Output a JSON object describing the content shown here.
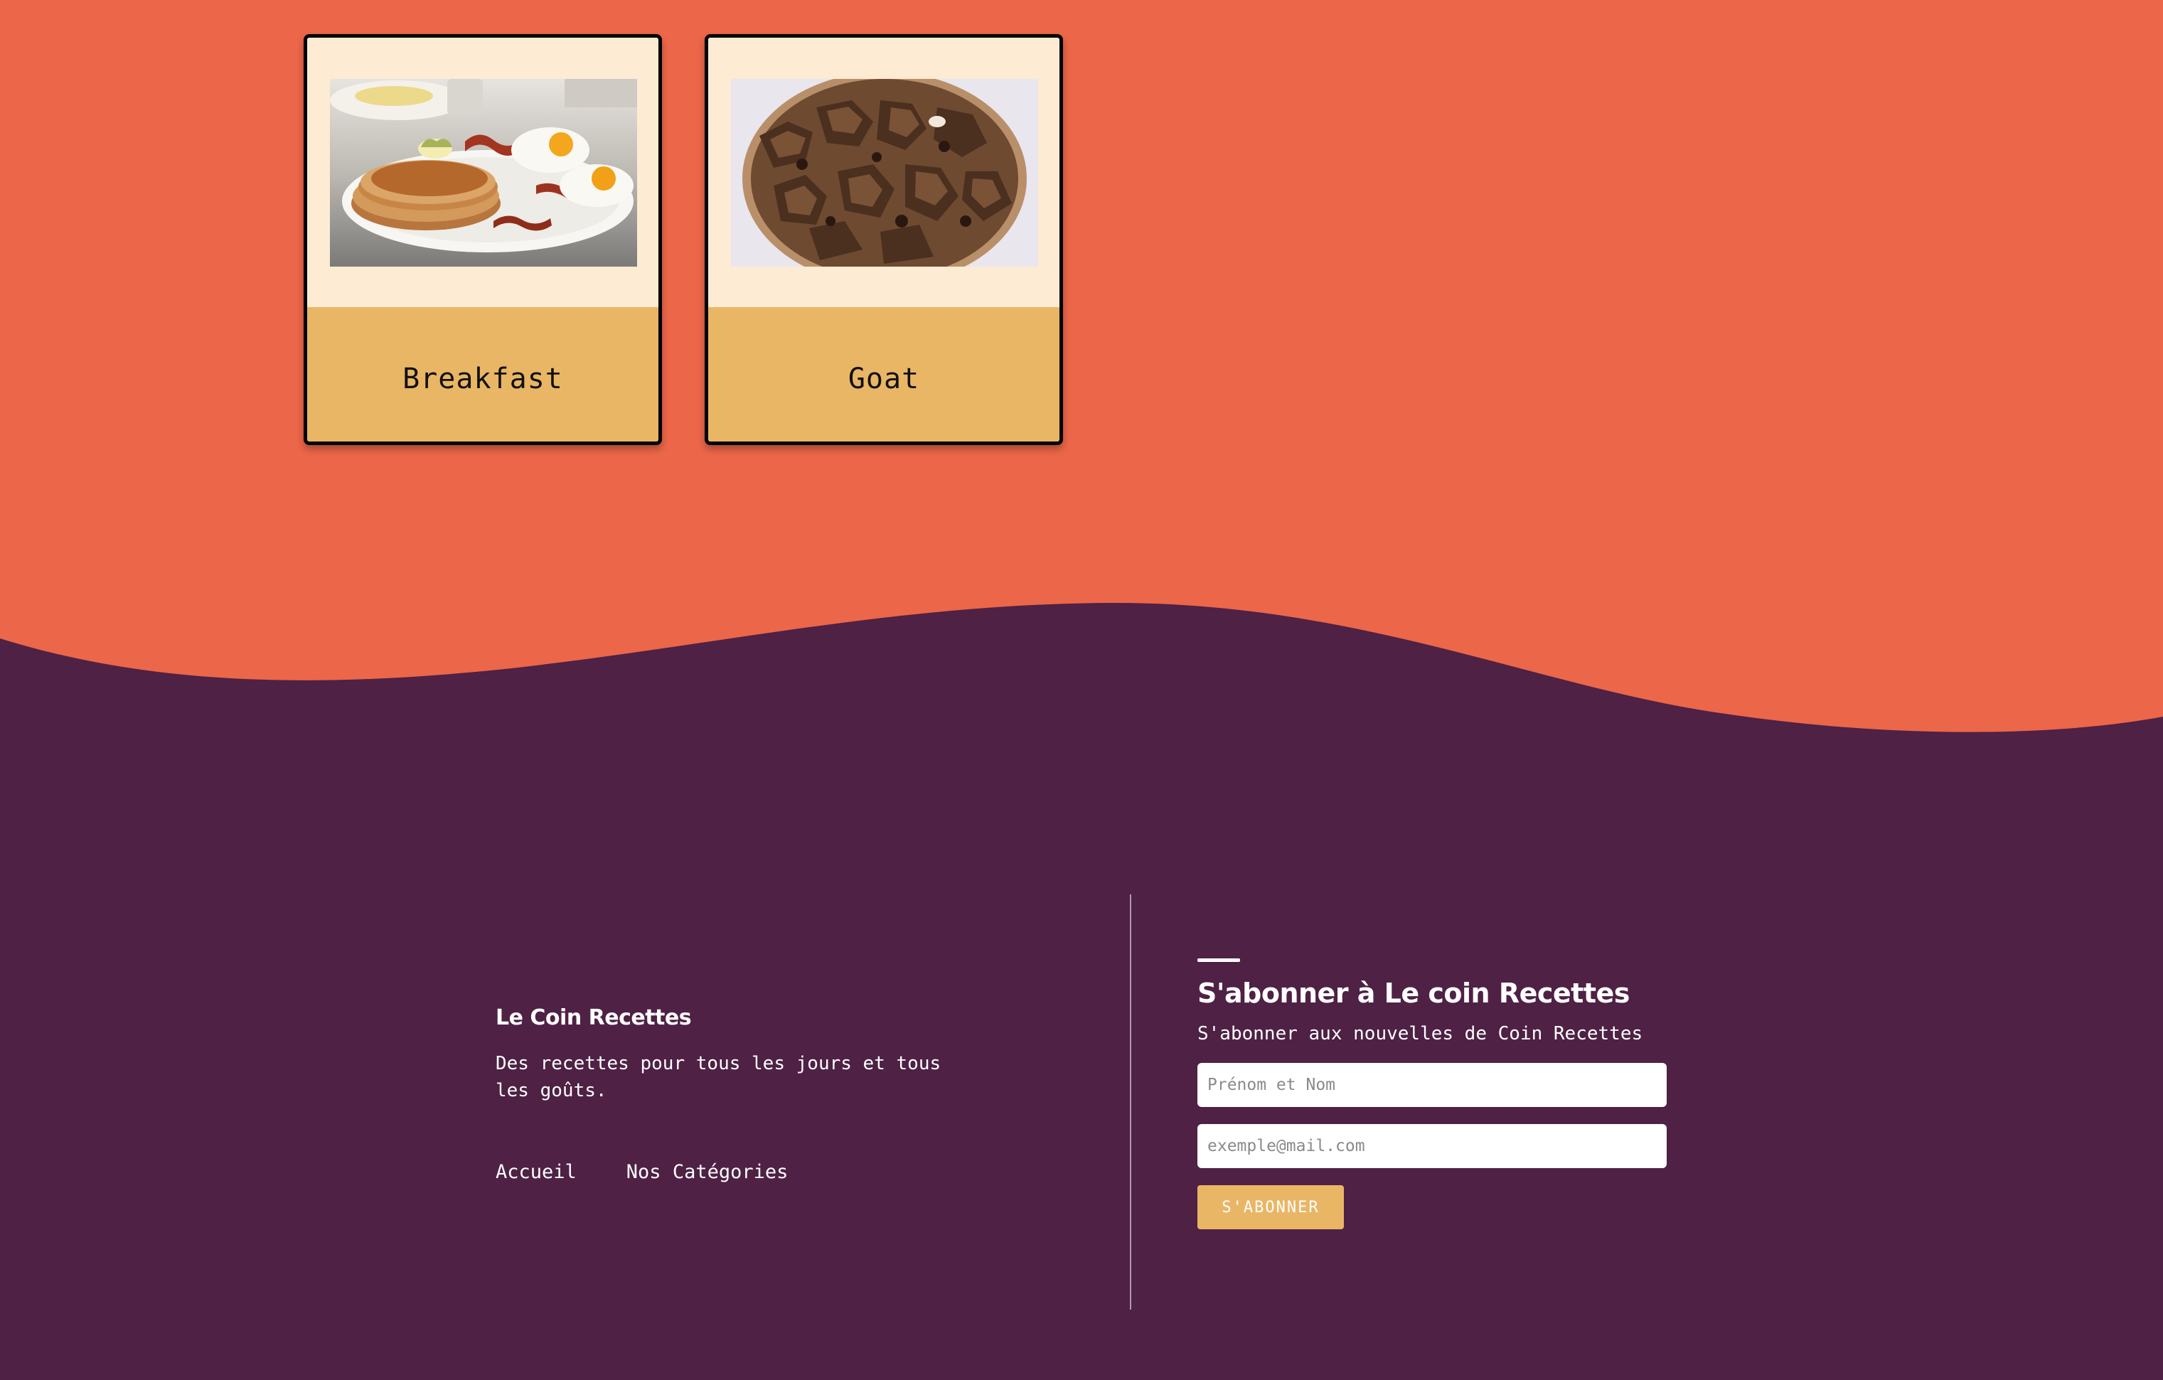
{
  "colors": {
    "top_background": "#ec6649",
    "footer_background": "#4e2145",
    "card_top": "#fdebd3",
    "card_bottom": "#e9b665",
    "button": "#e9b665"
  },
  "categories": [
    {
      "title": "Breakfast",
      "image": "pancakes-eggs-bacon-photo"
    },
    {
      "title": "Goat",
      "image": "grilled-goat-meat-bowl-photo"
    }
  ],
  "footer": {
    "brand": "Le Coin Recettes",
    "tagline": "Des recettes pour tous les jours et tous les goûts.",
    "links": [
      "Accueil",
      "Nos Catégories"
    ]
  },
  "subscribe": {
    "title": "S'abonner à Le coin Recettes",
    "subtitle": "S'abonner aux nouvelles de Coin Recettes",
    "name_placeholder": "Prénom et Nom",
    "email_placeholder": "exemple@mail.com",
    "button_label": "S'ABONNER"
  }
}
